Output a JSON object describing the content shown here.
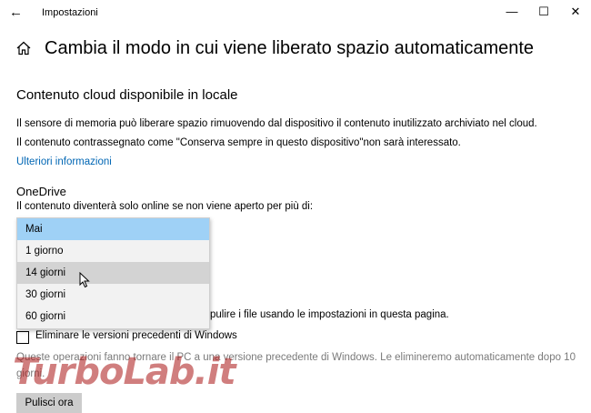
{
  "window": {
    "title": "Impostazioni",
    "back_icon": "←",
    "minimize_icon": "—",
    "maximize_icon": "☐",
    "close_icon": "✕"
  },
  "page": {
    "title": "Cambia il modo in cui viene liberato spazio automaticamente"
  },
  "cloud": {
    "heading": "Contenuto cloud disponibile in locale",
    "line1": "Il sensore di memoria può liberare spazio rimuovendo dal dispositivo il contenuto inutilizzato archiviato nel cloud.",
    "line2": "Il contenuto contrassegnato come \"Conserva sempre in questo dispositivo\"non sarà interessato.",
    "link": "Ulteriori informazioni"
  },
  "onedrive": {
    "heading": "OneDrive",
    "description": "Il contenuto diventerà solo online se non viene aperto per più di:",
    "options": [
      "Mai",
      "1 giorno",
      "14 giorni",
      "30 giorni",
      "60 giorni"
    ],
    "selected": "Mai",
    "hovered": "14 giorni"
  },
  "partial_text": "pulire i file usando le impostazioni in questa pagina.",
  "previous_versions": {
    "checkbox_label": "Eliminare le versioni precedenti di Windows",
    "checked": false,
    "desc1": "Queste operazioni fanno tornare il PC a una versione precedente di Windows. Le elimineremo automaticamente dopo 10",
    "desc2": "giorni."
  },
  "clean_button": "Pulisci ora",
  "watermark": "TurboLab.it",
  "colors": {
    "accent": "#0066b4",
    "selected": "#9fd1f6",
    "hover": "#d3d3d3"
  }
}
